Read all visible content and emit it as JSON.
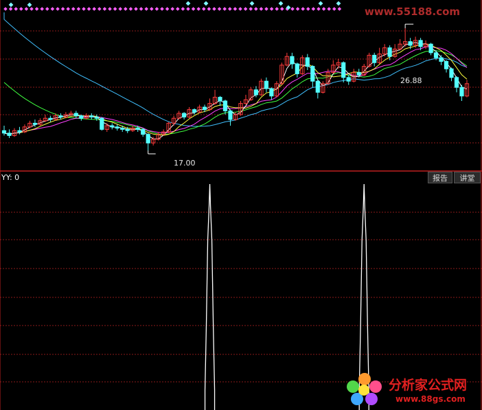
{
  "indicator": {
    "label": "YY: 0"
  },
  "buttons": {
    "report": "报告",
    "lecture": "讲堂"
  },
  "price": {
    "high": "26.88",
    "low": "17.00"
  },
  "watermarks": {
    "top": "www.55188.com",
    "brand": "分析家公式网",
    "url": "www.88gs.com"
  },
  "colors": {
    "up": "#ff3c3c",
    "down": "#54ffff",
    "ma5": "#ffffff",
    "ma10": "#ffff40",
    "ma20": "#ff40ff",
    "ma30": "#40ff40",
    "ma60": "#40c0ff",
    "signal": "#ff60ff",
    "grid": "#8b1a1a",
    "divider": "#c02020"
  },
  "chart_data": {
    "type": "candlestick",
    "candles": [
      [
        18.6,
        18.4,
        19.0,
        18.2
      ],
      [
        18.4,
        18.2,
        18.7,
        18.0
      ],
      [
        18.2,
        18.6,
        18.8,
        18.1
      ],
      [
        18.6,
        18.5,
        18.9,
        18.3
      ],
      [
        18.5,
        18.9,
        19.1,
        18.4
      ],
      [
        18.9,
        19.2,
        19.4,
        18.8
      ],
      [
        19.2,
        19.1,
        19.5,
        18.9
      ],
      [
        19.1,
        19.4,
        19.6,
        19.0
      ],
      [
        19.4,
        19.6,
        19.9,
        19.3
      ],
      [
        19.6,
        19.5,
        19.8,
        19.3
      ],
      [
        19.5,
        19.8,
        20.0,
        19.4
      ],
      [
        19.8,
        19.7,
        20.0,
        19.5
      ],
      [
        19.7,
        19.9,
        20.1,
        19.6
      ],
      [
        19.9,
        20.0,
        20.2,
        19.8
      ],
      [
        20.0,
        19.8,
        20.2,
        19.6
      ],
      [
        19.8,
        19.6,
        19.9,
        19.4
      ],
      [
        19.6,
        19.8,
        20.0,
        19.5
      ],
      [
        19.8,
        19.7,
        20.0,
        19.5
      ],
      [
        19.7,
        19.6,
        19.9,
        19.4
      ],
      [
        19.6,
        18.7,
        19.7,
        18.6
      ],
      [
        18.7,
        19.0,
        19.2,
        18.5
      ],
      [
        19.0,
        18.9,
        19.2,
        18.7
      ],
      [
        18.9,
        18.8,
        19.1,
        18.6
      ],
      [
        18.8,
        18.7,
        19.0,
        18.5
      ],
      [
        18.7,
        18.6,
        18.9,
        18.4
      ],
      [
        18.6,
        18.8,
        19.0,
        18.5
      ],
      [
        18.8,
        18.7,
        19.0,
        18.5
      ],
      [
        18.7,
        18.3,
        18.8,
        18.1
      ],
      [
        18.3,
        17.6,
        18.4,
        17.0
      ],
      [
        17.6,
        17.9,
        18.1,
        17.4
      ],
      [
        17.9,
        18.3,
        18.5,
        17.8
      ],
      [
        18.3,
        18.5,
        18.7,
        18.2
      ],
      [
        18.5,
        19.2,
        19.3,
        18.4
      ],
      [
        19.2,
        19.6,
        19.8,
        19.0
      ],
      [
        19.6,
        20.0,
        20.2,
        19.5
      ],
      [
        20.0,
        19.7,
        20.1,
        19.5
      ],
      [
        19.7,
        20.3,
        20.5,
        19.6
      ],
      [
        20.3,
        20.1,
        20.4,
        19.9
      ],
      [
        20.1,
        20.5,
        20.7,
        20.0
      ],
      [
        20.5,
        20.3,
        20.7,
        20.1
      ],
      [
        20.3,
        20.8,
        21.2,
        20.2
      ],
      [
        20.8,
        21.3,
        21.9,
        20.7
      ],
      [
        21.3,
        21.0,
        21.4,
        20.6
      ],
      [
        21.0,
        20.2,
        21.1,
        19.9
      ],
      [
        20.2,
        19.5,
        20.3,
        19.0
      ],
      [
        19.5,
        19.9,
        20.1,
        19.4
      ],
      [
        19.9,
        20.8,
        21.0,
        19.8
      ],
      [
        20.8,
        21.1,
        21.5,
        20.7
      ],
      [
        21.1,
        21.9,
        22.1,
        21.0
      ],
      [
        21.9,
        21.5,
        22.2,
        21.3
      ],
      [
        21.5,
        22.6,
        22.8,
        21.4
      ],
      [
        22.6,
        22.0,
        22.9,
        21.7
      ],
      [
        22.0,
        21.4,
        22.1,
        21.1
      ],
      [
        21.4,
        22.4,
        22.6,
        21.3
      ],
      [
        22.4,
        23.9,
        24.1,
        22.3
      ],
      [
        23.9,
        24.6,
        24.9,
        23.8
      ],
      [
        24.6,
        24.0,
        24.9,
        23.6
      ],
      [
        24.0,
        23.2,
        24.1,
        22.9
      ],
      [
        23.2,
        24.5,
        24.7,
        23.1
      ],
      [
        24.5,
        23.8,
        24.8,
        23.5
      ],
      [
        23.8,
        22.6,
        23.9,
        22.1
      ],
      [
        22.6,
        21.7,
        22.7,
        21.2
      ],
      [
        21.7,
        22.4,
        22.6,
        21.6
      ],
      [
        22.4,
        23.3,
        23.6,
        22.3
      ],
      [
        23.3,
        23.9,
        24.3,
        23.2
      ],
      [
        23.9,
        24.1,
        24.4,
        23.6
      ],
      [
        24.1,
        22.9,
        24.2,
        22.5
      ],
      [
        22.9,
        22.6,
        23.1,
        22.3
      ],
      [
        22.6,
        23.3,
        23.6,
        22.5
      ],
      [
        23.3,
        23.1,
        23.6,
        22.9
      ],
      [
        23.1,
        23.8,
        24.0,
        23.0
      ],
      [
        23.8,
        24.7,
        24.9,
        23.7
      ],
      [
        24.7,
        24.1,
        24.9,
        23.8
      ],
      [
        24.1,
        24.8,
        25.3,
        24.0
      ],
      [
        24.8,
        25.3,
        25.6,
        24.6
      ],
      [
        25.3,
        24.6,
        25.5,
        24.3
      ],
      [
        24.6,
        25.2,
        25.6,
        24.5
      ],
      [
        25.2,
        25.6,
        26.0,
        25.1
      ],
      [
        25.6,
        25.8,
        26.88,
        25.4
      ],
      [
        25.8,
        25.5,
        26.1,
        25.2
      ],
      [
        25.5,
        25.9,
        26.2,
        25.3
      ],
      [
        25.9,
        25.4,
        26.1,
        25.1
      ],
      [
        25.4,
        25.6,
        25.9,
        25.2
      ],
      [
        25.6,
        24.9,
        25.7,
        24.7
      ],
      [
        24.9,
        24.5,
        25.1,
        24.3
      ],
      [
        24.5,
        24.2,
        24.7,
        23.9
      ],
      [
        24.2,
        23.6,
        24.3,
        23.3
      ],
      [
        23.6,
        22.9,
        23.7,
        22.6
      ],
      [
        22.9,
        22.1,
        23.0,
        21.7
      ],
      [
        22.1,
        21.4,
        22.3,
        21.0
      ],
      [
        21.4,
        22.4,
        22.7,
        21.3
      ]
    ],
    "annotations": {
      "high": 26.88,
      "low": 17.0
    },
    "signal_peaks": [
      40,
      70
    ],
    "indicator_value": 0
  }
}
